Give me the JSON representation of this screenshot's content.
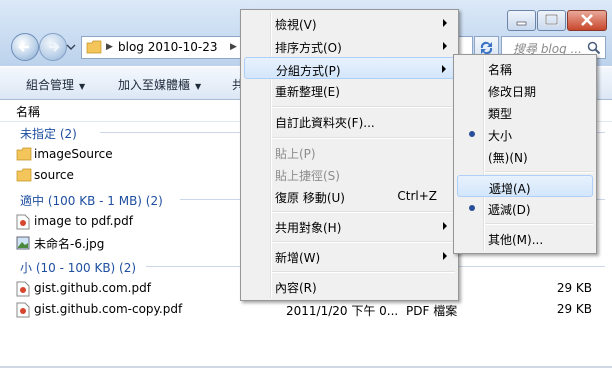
{
  "address": {
    "crumb": "blog  2010-10-23"
  },
  "search": {
    "placeholder": "搜尋 blog ..."
  },
  "toolbar": {
    "organize": "組合管理",
    "add_media": "加入至媒體櫃",
    "cut_label": "共"
  },
  "columns": {
    "name": "名稱"
  },
  "groups": [
    {
      "label": "未指定 (2)"
    },
    {
      "label": "適中 (100 KB - 1 MB) (2)"
    },
    {
      "label": "小 (10 - 100 KB) (2)"
    }
  ],
  "files": [
    {
      "name": "imageSource",
      "date": "",
      "type": "",
      "size": ""
    },
    {
      "name": "source",
      "date": "",
      "type": "",
      "size": ""
    },
    {
      "name": "image to pdf.pdf",
      "date": "",
      "type": "",
      "size": ""
    },
    {
      "name": "未命名-6.jpg",
      "date": "",
      "type": "",
      "size": ""
    },
    {
      "name": "gist.github.com.pdf",
      "date": "",
      "type": "",
      "size": "29 KB"
    },
    {
      "name": "gist.github.com-copy.pdf",
      "date": "2011/1/20 下午 0...",
      "type": "PDF 檔案",
      "size": "29 KB"
    }
  ],
  "context_menu": {
    "view": "檢視(V)",
    "sort": "排序方式(O)",
    "group": "分組方式(P)",
    "refresh": "重新整理(E)",
    "customize": "自訂此資料夾(F)...",
    "paste": "貼上(P)",
    "paste_shortcut": "貼上捷徑(S)",
    "undo_move": "復原 移動(U)",
    "undo_shortcut": "Ctrl+Z",
    "share": "共用對象(H)",
    "new": "新增(W)",
    "properties": "內容(R)"
  },
  "submenu": {
    "name": "名稱",
    "modified": "修改日期",
    "type": "類型",
    "size": "大小",
    "none": "(無)(N)",
    "ascending": "遞增(A)",
    "descending": "遞減(D)",
    "more": "其他(M)..."
  },
  "colors": {
    "accent_blue": "#1e4fa0",
    "highlight": "#d3e6fb"
  }
}
